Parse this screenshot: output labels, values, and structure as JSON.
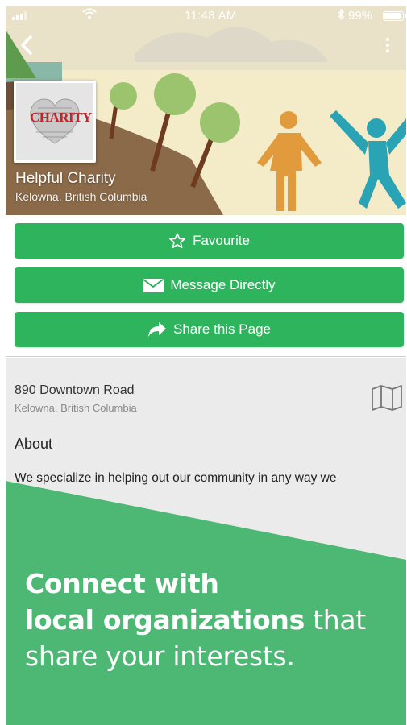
{
  "status_bar": {
    "time": "11:48 AM",
    "battery_percent": "99%",
    "bluetooth_icon": "bluetooth-icon",
    "wifi_icon": "wifi-icon"
  },
  "header": {
    "back_icon": "chevron-left-icon",
    "more_icon": "vertical-dots-icon"
  },
  "organization": {
    "logo_text": "CHARITY",
    "name": "Helpful Charity",
    "location": "Kelowna, British Columbia"
  },
  "actions": [
    {
      "label": "Favourite",
      "icon": "star-outline-icon"
    },
    {
      "label": "Message Directly",
      "icon": "envelope-icon"
    },
    {
      "label": "Share this Page",
      "icon": "share-arrow-icon"
    }
  ],
  "address": {
    "line1": "890 Downtown Road",
    "line2": "Kelowna, British Columbia",
    "icon": "map-icon"
  },
  "about": {
    "title": "About",
    "text": "We specialize in helping out our community in any way we"
  },
  "promo": {
    "line1": "Connect with",
    "line2_bold": "local organizations",
    "line2_rest": " that",
    "line3": "share your interests."
  },
  "colors": {
    "primary_green": "#2fb45e",
    "promo_green": "#4db874",
    "info_background": "#ebebeb"
  }
}
